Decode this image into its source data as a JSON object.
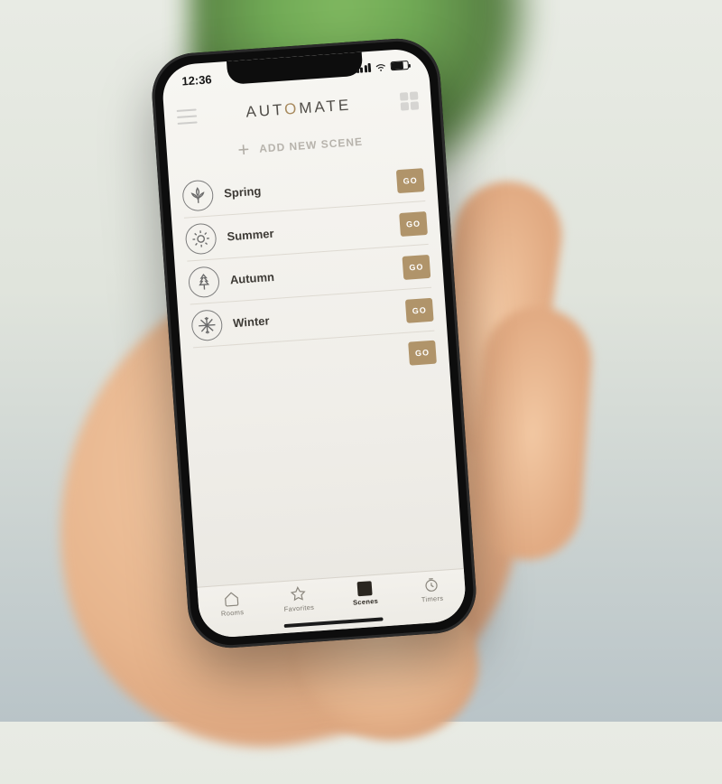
{
  "status": {
    "time": "12:36"
  },
  "header": {
    "brand_a": "AUT",
    "brand_o": "O",
    "brand_b": "MATE"
  },
  "add": {
    "label": "ADD NEW SCENE"
  },
  "scenes": [
    {
      "label": "Spring",
      "go": "GO"
    },
    {
      "label": "Summer",
      "go": "GO"
    },
    {
      "label": "Autumn",
      "go": "GO"
    },
    {
      "label": "Winter",
      "go": "GO"
    }
  ],
  "extra_go": "GO",
  "tabs": [
    {
      "label": "Rooms"
    },
    {
      "label": "Favorites"
    },
    {
      "label": "Scenes"
    },
    {
      "label": "Timers"
    }
  ]
}
